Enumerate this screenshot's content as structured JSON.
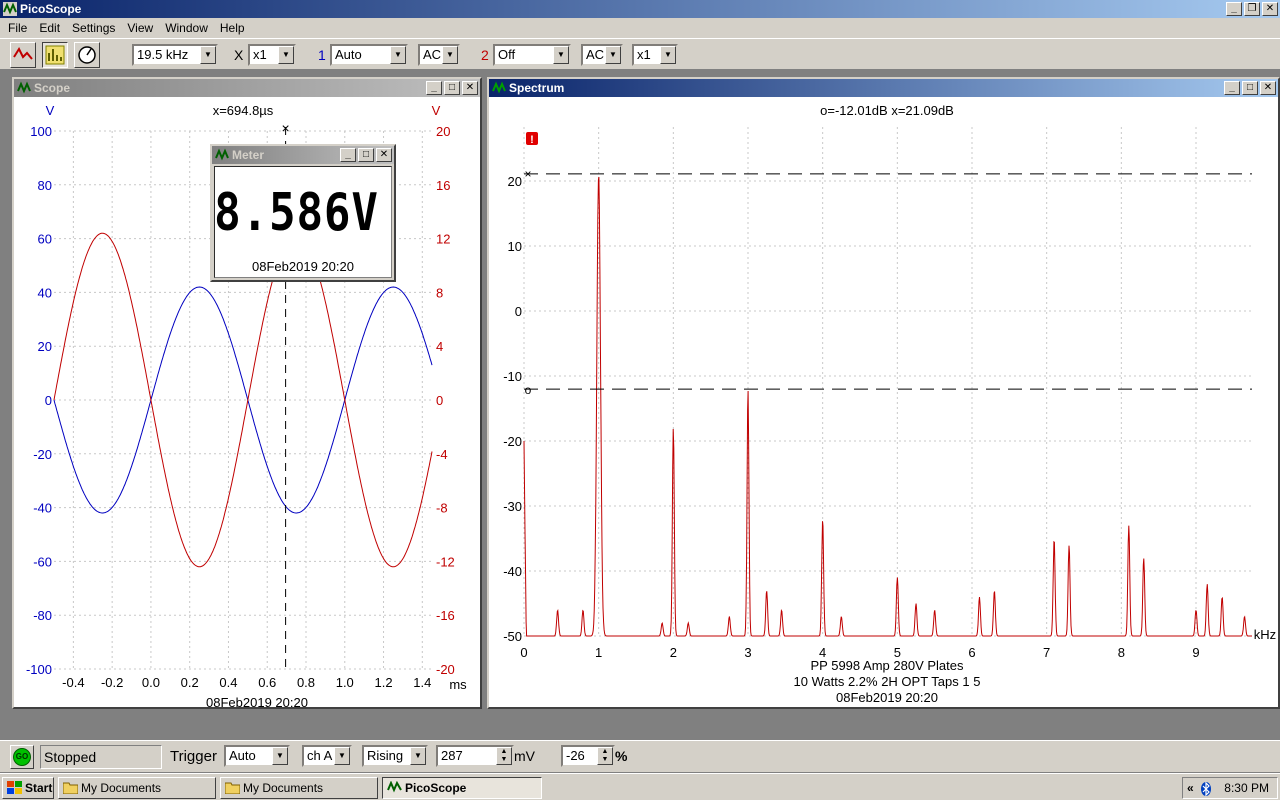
{
  "app": {
    "title": "PicoScope"
  },
  "menu": [
    "File",
    "Edit",
    "Settings",
    "View",
    "Window",
    "Help"
  ],
  "toolbar": {
    "timebase": "19.5 kHz",
    "x_label": "X",
    "x_mult": "x1",
    "ch1_label": "1",
    "ch1_range": "Auto",
    "ch1_coupling": "AC",
    "ch2_label": "2",
    "ch2_range": "Off",
    "ch2_coupling": "AC",
    "ch2_mult": "x1"
  },
  "scope": {
    "title": "Scope",
    "cursor_readout": "x=694.8µs",
    "left_unit": "V",
    "right_unit": "V",
    "x_unit": "ms",
    "date": "08Feb2019  20:20",
    "left_ticks": [
      "100",
      "80",
      "60",
      "40",
      "20",
      "0",
      "-20",
      "-40",
      "-60",
      "-80",
      "-100"
    ],
    "right_ticks": [
      "20",
      "16",
      "12",
      "8",
      "4",
      "0",
      "-4",
      "-8",
      "-12",
      "-16",
      "-20"
    ],
    "x_ticks": [
      "-0.4",
      "-0.2",
      "0.0",
      "0.2",
      "0.4",
      "0.6",
      "0.8",
      "1.0",
      "1.2",
      "1.4"
    ],
    "colors": {
      "left_axis": "#0000c0",
      "right_axis": "#c00000"
    }
  },
  "meter": {
    "title": "Meter",
    "value": "8.586V",
    "date": "08Feb2019  20:20"
  },
  "spectrum": {
    "title": "Spectrum",
    "readout": "o=-12.01dB  x=21.09dB",
    "x_unit": "kHz",
    "y_ticks": [
      "20",
      "10",
      "0",
      "-10",
      "-20",
      "-30",
      "-40",
      "-50"
    ],
    "x_ticks": [
      "0",
      "1",
      "2",
      "3",
      "4",
      "5",
      "6",
      "7",
      "8",
      "9"
    ],
    "cursor_o_label": "o",
    "cursor_x_label": "×",
    "caption_line1": "PP 5998  Amp 280V Plates",
    "caption_line2": "10 Watts 2.2% 2H OPT Taps 1 5",
    "date": "08Feb2019  20:20",
    "warning": "!"
  },
  "status": {
    "go_label": "GO",
    "state": "Stopped",
    "trigger_label": "Trigger",
    "trigger_mode": "Auto",
    "trigger_channel": "ch A",
    "trigger_edge": "Rising",
    "trigger_level": "287",
    "level_unit": "mV",
    "pretrigger": "-26",
    "pretrigger_unit": "%"
  },
  "taskbar": {
    "start": "Start",
    "tasks": [
      "My Documents",
      "My Documents",
      "PicoScope"
    ],
    "tray_arrows": "«",
    "clock": "8:30 PM"
  },
  "chart_data": [
    {
      "type": "line",
      "title": "",
      "xlabel": "ms",
      "ylabel": "V",
      "xlim": [
        -0.5,
        1.45
      ],
      "ylim": [
        -100,
        100
      ],
      "y2lim": [
        -20,
        20
      ],
      "grid": true,
      "series": [
        {
          "axis": "left",
          "color": "#0000c0",
          "shape": "sine",
          "amplitude": 42,
          "period_ms": 1.0,
          "peak_at_ms": 0.25
        },
        {
          "axis": "right",
          "color": "#c00000",
          "shape": "sine",
          "amplitude": 12.4,
          "period_ms": 1.0,
          "peak_at_ms": -0.25
        }
      ],
      "cursor_x_ms": 0.6948
    },
    {
      "type": "line",
      "title": "",
      "xlabel": "kHz",
      "ylabel": "dB",
      "xlim": [
        0,
        9.75
      ],
      "ylim": [
        -50,
        22
      ],
      "grid": true,
      "floor_db": -50,
      "peaks": [
        {
          "x": 0.45,
          "y": -46
        },
        {
          "x": 0.79,
          "y": -46
        },
        {
          "x": 1.0,
          "y": 21.09
        },
        {
          "x": 1.85,
          "y": -48
        },
        {
          "x": 2.0,
          "y": -18
        },
        {
          "x": 2.2,
          "y": -48
        },
        {
          "x": 2.75,
          "y": -47
        },
        {
          "x": 3.0,
          "y": -12.01
        },
        {
          "x": 3.25,
          "y": -43
        },
        {
          "x": 3.45,
          "y": -46
        },
        {
          "x": 4.0,
          "y": -32
        },
        {
          "x": 4.25,
          "y": -47
        },
        {
          "x": 5.0,
          "y": -41
        },
        {
          "x": 5.25,
          "y": -45
        },
        {
          "x": 5.5,
          "y": -46
        },
        {
          "x": 6.1,
          "y": -44
        },
        {
          "x": 6.3,
          "y": -43
        },
        {
          "x": 7.1,
          "y": -35
        },
        {
          "x": 7.3,
          "y": -36
        },
        {
          "x": 8.1,
          "y": -33
        },
        {
          "x": 8.3,
          "y": -38
        },
        {
          "x": 9.0,
          "y": -46
        },
        {
          "x": 9.15,
          "y": -42
        },
        {
          "x": 9.35,
          "y": -44
        },
        {
          "x": 9.65,
          "y": -47
        }
      ],
      "cursor_o_db": -12.01,
      "cursor_x_db": 21.09
    }
  ]
}
